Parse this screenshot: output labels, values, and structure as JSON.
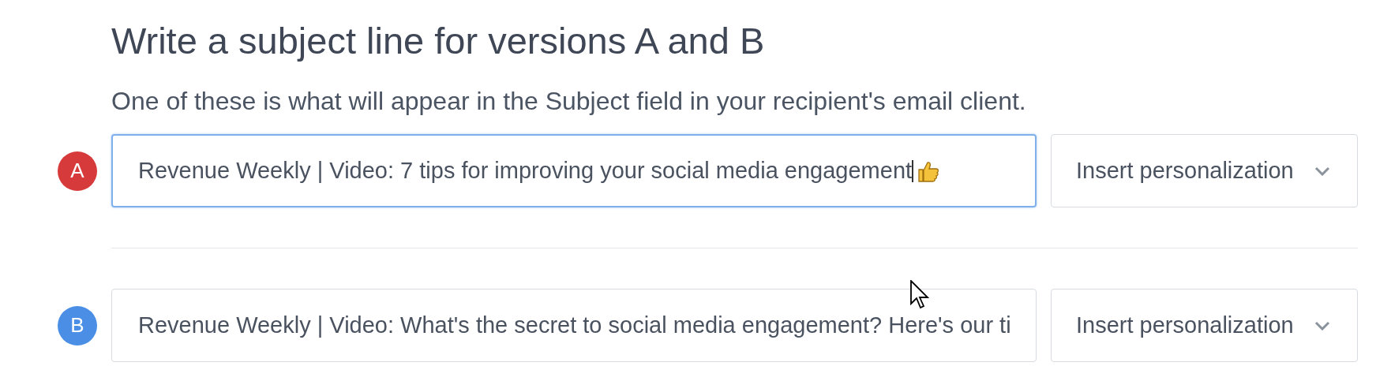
{
  "heading": "Write a subject line for versions A and B",
  "description": "One of these is what will appear in the Subject field in your recipient's email client.",
  "versions": [
    {
      "badge": "A",
      "color": "#d63a3a",
      "value": "Revenue Weekly | Video: 7 tips for improving your social media engagement",
      "focused": true,
      "emoji": true,
      "personalization": "Insert personalization"
    },
    {
      "badge": "B",
      "color": "#4a8ee6",
      "value": "Revenue Weekly | Video: What's the secret to social media engagement? Here's our ti",
      "focused": false,
      "emoji": false,
      "personalization": "Insert personalization"
    }
  ]
}
